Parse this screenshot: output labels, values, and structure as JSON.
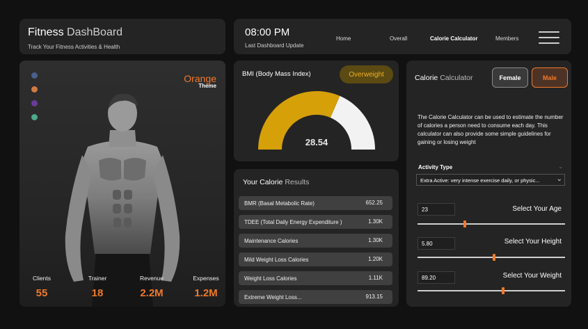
{
  "header": {
    "title_strong": "Fitness",
    "title_light": "DashBoard",
    "subtitle": "Track Your Fitness Activities & Health"
  },
  "status": {
    "time": "08:00 PM",
    "time_label": "Last Dashboard Update"
  },
  "nav": {
    "items": [
      "Home",
      "Overall",
      "Calorie Calculator",
      "Members"
    ],
    "active": "Calorie Calculator"
  },
  "theme": {
    "name": "Orange",
    "label": "Theme",
    "swatches": [
      "#4a5f8a",
      "#d07a45",
      "#6a3c95",
      "#4fa88a"
    ]
  },
  "stats": [
    {
      "label": "Clients",
      "value": "55"
    },
    {
      "label": "Trainer",
      "value": "18"
    },
    {
      "label": "Revenue",
      "value": "2.2M"
    },
    {
      "label": "Expenses",
      "value": "1.2M"
    }
  ],
  "bmi": {
    "title": "BMI (Body Mass Index)",
    "status": "Overweight",
    "value": "28.54",
    "fill_fraction": 0.63
  },
  "calories": {
    "title_strong": "Your Calorie",
    "title_light": "Results",
    "rows": [
      {
        "label": "BMR (Basal Metabolic Rate)",
        "value": "652.25"
      },
      {
        "label": "TDEE (Total Daily Energy Expenditure )",
        "value": "1.30K"
      },
      {
        "label": "Maintenance Calories",
        "value": "1.30K"
      },
      {
        "label": "Mild Weight Loss Calories",
        "value": "1.20K"
      },
      {
        "label": "Weight Loss Calories",
        "value": "1.11K"
      },
      {
        "label": "Extreme Weight Loss...",
        "value": "913.15"
      }
    ]
  },
  "calculator": {
    "title_strong": "Calorie",
    "title_light": "Calculator",
    "female_label": "Female",
    "male_label": "Male",
    "description": "The Calorie Calculator can be used to estimate the number of calories a person need to consume each day. This calculator can also provide some simple guidelines for gaining or losing weight",
    "activity_label": "Activity Type",
    "activity_value": "Extra Active: very intense exercise daily, or physic...",
    "age": {
      "value": "23",
      "label": "Select Your Age",
      "position": 0.32
    },
    "height": {
      "value": "5.80",
      "label": "Select Your Height",
      "position": 0.52
    },
    "weight": {
      "value": "89.20",
      "label": "Select Your Weight",
      "position": 0.58
    }
  },
  "colors": {
    "accent": "#f07a2a",
    "gauge_fill": "#d6a008",
    "gauge_rest": "#f2f2f2"
  }
}
